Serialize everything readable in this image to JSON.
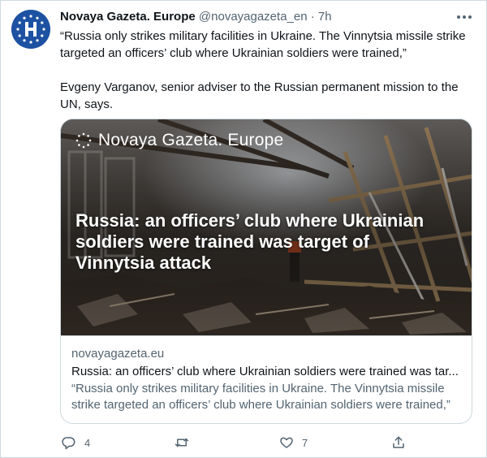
{
  "tweet": {
    "display_name": "Novaya Gazeta. Europe",
    "handle": "@novayagazeta_en",
    "separator": "·",
    "time": "7h",
    "paragraphs": [
      "“Russia only strikes military facilities in Ukraine. The Vinnytsia missile strike targeted an officers’ club where Ukrainian soldiers were trained,”",
      "Evgeny Varganov, senior adviser to the Russian permanent mission to the UN, says."
    ],
    "more_icon": "more-horizontal-icon"
  },
  "card": {
    "brand": "Novaya Gazeta. Europe",
    "headline": "Russia: an officers’ club where Ukrainian soldiers were trained was target of Vinnytsia attack",
    "domain": "novayagazeta.eu",
    "title": "Russia: an officers’ club where Ukrainian soldiers were trained was tar...",
    "description": "“Russia only strikes military facilities in Ukraine. The Vinnytsia missile strike targeted an officers’ club where Ukrainian soldiers were trained,”"
  },
  "actions": {
    "reply_count": "4",
    "retweet_count": "",
    "like_count": "7",
    "icons": [
      "reply-icon",
      "retweet-icon",
      "like-icon",
      "share-icon"
    ]
  },
  "colors": {
    "text": "#0f1419",
    "secondary": "#536471",
    "border": "#cfd9de",
    "avatar_blue": "#1d52a3"
  }
}
